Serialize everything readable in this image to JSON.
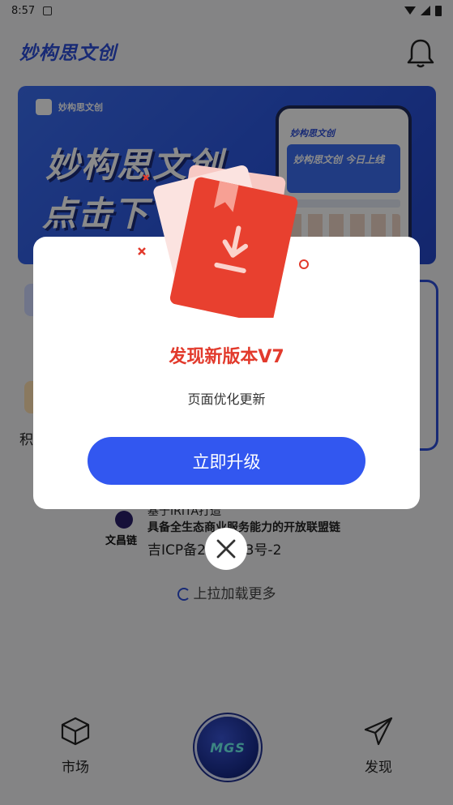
{
  "status": {
    "time": "8:57"
  },
  "header": {
    "brand": "妙构思文创"
  },
  "banner": {
    "logo_text": "妙构思文创",
    "title_line1": "妙构思文创",
    "title_line2": "点击下",
    "phone_title": "妙构思文创",
    "phone_card": "妙构思文创 今日上线"
  },
  "background": {
    "points_label": "积"
  },
  "footer_info": {
    "logo_text": "文昌链",
    "line1": "基于IRITA打造",
    "line2": "具备全生态商业服务能力的开放联盟链",
    "line3": "吉ICP备2 07183号-2"
  },
  "loadmore": {
    "text": "上拉加载更多"
  },
  "tabbar": {
    "market": "市场",
    "center": "MGS",
    "discover": "发现"
  },
  "modal": {
    "title": "发现新版本V7",
    "description": "页面优化更新",
    "upgrade_label": "立即升级"
  },
  "colors": {
    "brand_blue": "#3257f0",
    "title_red": "#e23a2c"
  }
}
